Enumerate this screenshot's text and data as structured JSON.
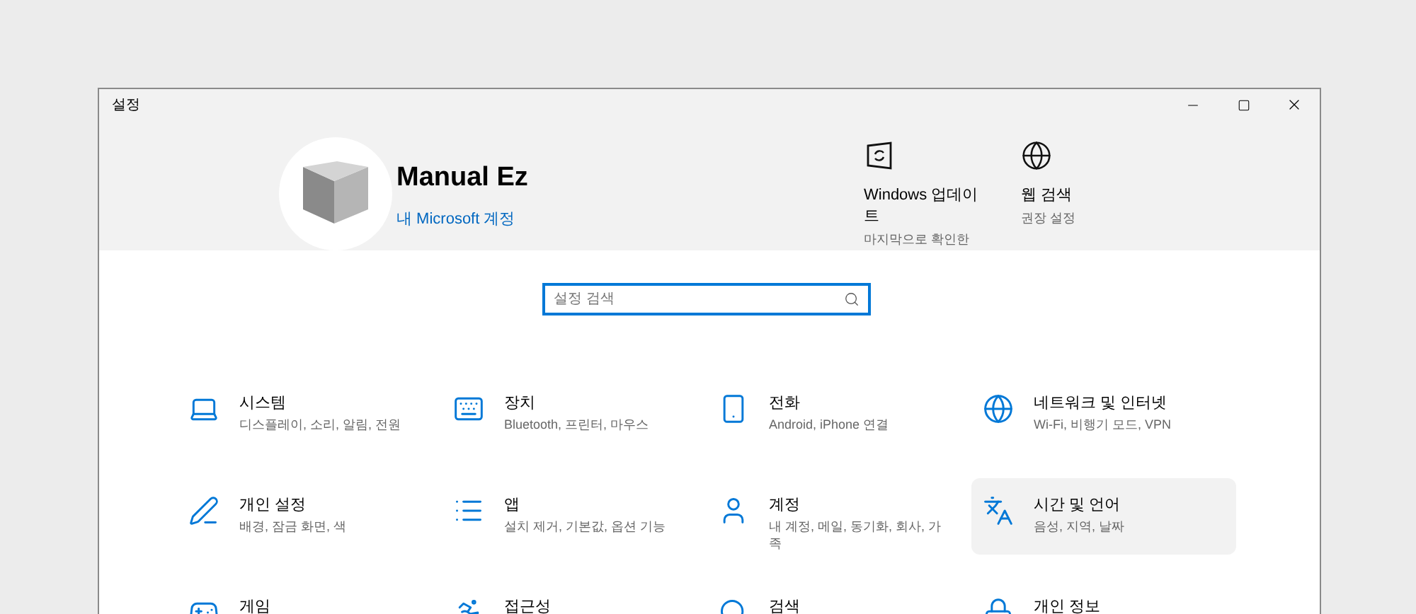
{
  "window": {
    "title": "설정"
  },
  "account": {
    "name": "Manual Ez",
    "link": "내 Microsoft 계정"
  },
  "quick_links": [
    {
      "title": "Windows 업데이트",
      "subtitle": "마지막으로 확인한"
    },
    {
      "title": "웹 검색",
      "subtitle": "권장 설정"
    }
  ],
  "search": {
    "placeholder": "설정 검색"
  },
  "categories": [
    {
      "title": "시스템",
      "subtitle": "디스플레이, 소리, 알림, 전원",
      "selected": false
    },
    {
      "title": "장치",
      "subtitle": "Bluetooth, 프린터, 마우스",
      "selected": false
    },
    {
      "title": "전화",
      "subtitle": "Android, iPhone 연결",
      "selected": false
    },
    {
      "title": "네트워크 및 인터넷",
      "subtitle": "Wi-Fi, 비행기 모드, VPN",
      "selected": false
    },
    {
      "title": "개인 설정",
      "subtitle": "배경, 잠금 화면, 색",
      "selected": false
    },
    {
      "title": "앱",
      "subtitle": "설치 제거, 기본값, 옵션 기능",
      "selected": false
    },
    {
      "title": "계정",
      "subtitle": "내 계정, 메일, 동기화, 회사, 가족",
      "selected": false
    },
    {
      "title": "시간 및 언어",
      "subtitle": "음성, 지역, 날짜",
      "selected": true
    },
    {
      "title": "게임",
      "selected": false
    },
    {
      "title": "접근성",
      "selected": false
    },
    {
      "title": "검색",
      "selected": false
    },
    {
      "title": "개인 정보",
      "selected": false
    }
  ]
}
